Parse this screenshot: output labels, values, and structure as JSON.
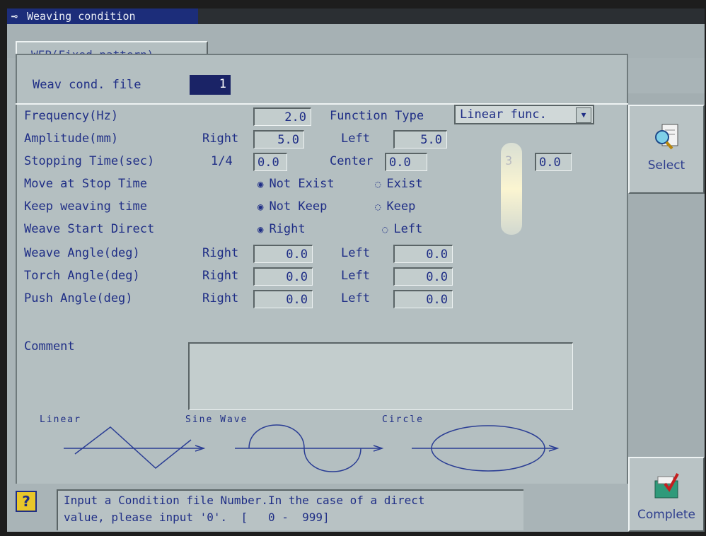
{
  "window": {
    "title": "Weaving condition"
  },
  "tab": {
    "label": "WFP(Fixed pattern)"
  },
  "file": {
    "label": "Weav cond. file",
    "value": "1"
  },
  "rows": {
    "frequency": {
      "label": "Frequency(Hz)",
      "value": "2.0",
      "function_label": "Function Type",
      "function_value": "Linear func."
    },
    "amplitude": {
      "label": "Amplitude(mm)",
      "right_label": "Right",
      "right": "5.0",
      "left_label": "Left",
      "left": "5.0"
    },
    "stopping": {
      "label": "Stopping Time(sec)",
      "q1_label": "1/4",
      "q1": "0.0",
      "center_label": "Center",
      "center": "0.0",
      "q3_label": "3",
      "q3": "0.0"
    },
    "move_stop": {
      "label": "Move at Stop Time",
      "opt1": "Not Exist",
      "opt2": "Exist",
      "selected": "Not Exist"
    },
    "keep_weaving": {
      "label": "Keep weaving time",
      "opt1": "Not Keep",
      "opt2": "Keep",
      "selected": "Not Keep"
    },
    "start_direct": {
      "label": "Weave Start Direct",
      "opt1": "Right",
      "opt2": "Left",
      "selected": "Right"
    },
    "weave_angle": {
      "label": "Weave Angle(deg)",
      "right_label": "Right",
      "right": "0.0",
      "left_label": "Left",
      "left": "0.0"
    },
    "torch_angle": {
      "label": "Torch Angle(deg)",
      "right_label": "Right",
      "right": "0.0",
      "left_label": "Left",
      "left": "0.0"
    },
    "push_angle": {
      "label": "Push Angle(deg)",
      "right_label": "Right",
      "right": "0.0",
      "left_label": "Left",
      "left": "0.0"
    },
    "comment": {
      "label": "Comment",
      "value": ""
    }
  },
  "waves": {
    "linear": "Linear",
    "sine": "Sine Wave",
    "circle": "Circle"
  },
  "buttons": {
    "select": "Select",
    "complete": "Complete"
  },
  "status": {
    "message": "Input a Condition file Number.In the case of a direct\nvalue, please input '0'.  [   0 -  999]"
  },
  "icons": {
    "help": "help-question-icon",
    "select": "magnifier-document-icon",
    "complete": "checkmark-folder-icon",
    "title": "weld-torch-icon"
  },
  "colors": {
    "text": "#1f2e86",
    "title_bar": "#1c2d7a",
    "panel": "#b4bfc1"
  }
}
